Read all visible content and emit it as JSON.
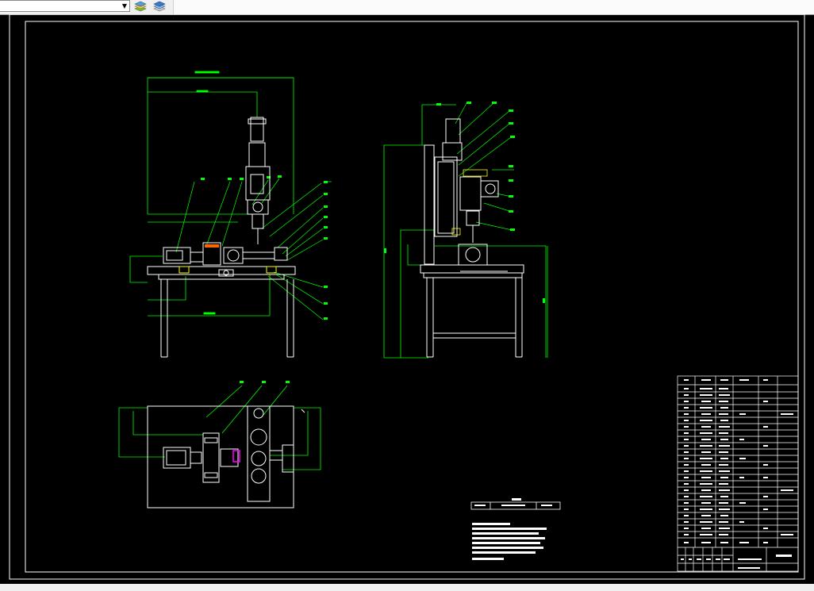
{
  "toolbar": {
    "layer_value": "",
    "icons": [
      "layer-states-icon",
      "layer-stack-icon"
    ]
  },
  "status_bar": {
    "text": ""
  },
  "drawing": {
    "background": "#000000",
    "frame_color": "#ffffff",
    "dimension_color": "#00ff00",
    "highlight_color": "#ff00ff"
  }
}
